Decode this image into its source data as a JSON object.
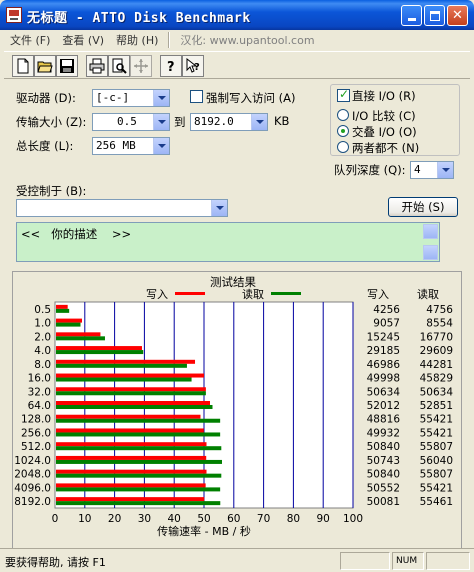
{
  "window": {
    "title": "无标题 - ATTO Disk Benchmark"
  },
  "menu": {
    "items": [
      "文件 (F)",
      "查看 (V)",
      "帮助 (H)"
    ],
    "extra": "汉化: www.upantool.com"
  },
  "toolbar": {
    "icons": [
      "new-file-icon",
      "open-folder-icon",
      "save-icon",
      "print-icon",
      "print-preview-icon",
      "move-icon",
      "help-icon",
      "context-help-icon"
    ]
  },
  "form": {
    "drive_label": "驱动器 (D):",
    "drive_value": "[-c-]",
    "force_write_label": "强制写入访问 (A)",
    "direct_io_label": "直接 I/O (R)",
    "transfer_size_label": "传输大小 (Z):",
    "transfer_from": "0.5",
    "to_label": "到",
    "transfer_to": "8192.0",
    "kb_label": "KB",
    "total_length_label": "总长度 (L):",
    "total_length_value": "256 MB",
    "io_compare_label": "I/O 比较 (C)",
    "overlapped_io_label": "交叠 I/O (O)",
    "neither_label": "两者都不 (N)",
    "queue_depth_label": "队列深度 (Q):",
    "queue_depth_value": "4",
    "controlled_by_label": "受控制于 (B):",
    "controlled_by_value": "",
    "start_button": "开始 (S)",
    "description": "<<   你的描述    >>"
  },
  "results": {
    "title": "测试结果",
    "legend_write": "写入",
    "legend_read": "读取",
    "col_write": "写入",
    "col_read": "读取",
    "write_color": "#ff0000",
    "read_color": "#008000",
    "rows": [
      {
        "size": "0.5",
        "write": "4256",
        "read": "4756"
      },
      {
        "size": "1.0",
        "write": "9057",
        "read": "8554"
      },
      {
        "size": "2.0",
        "write": "15245",
        "read": "16770"
      },
      {
        "size": "4.0",
        "write": "29185",
        "read": "29609"
      },
      {
        "size": "8.0",
        "write": "46986",
        "read": "44281"
      },
      {
        "size": "16.0",
        "write": "49998",
        "read": "45829"
      },
      {
        "size": "32.0",
        "write": "50634",
        "read": "50634"
      },
      {
        "size": "64.0",
        "write": "52012",
        "read": "52851"
      },
      {
        "size": "128.0",
        "write": "48816",
        "read": "55421"
      },
      {
        "size": "256.0",
        "write": "49932",
        "read": "55421"
      },
      {
        "size": "512.0",
        "write": "50840",
        "read": "55807"
      },
      {
        "size": "1024.0",
        "write": "50743",
        "read": "56040"
      },
      {
        "size": "2048.0",
        "write": "50840",
        "read": "55807"
      },
      {
        "size": "4096.0",
        "write": "50552",
        "read": "55421"
      },
      {
        "size": "8192.0",
        "write": "50081",
        "read": "55461"
      }
    ],
    "xlabel": "传输速率 - MB / 秒"
  },
  "chart_data": {
    "type": "bar",
    "orientation": "horizontal",
    "categories": [
      "0.5",
      "1.0",
      "2.0",
      "4.0",
      "8.0",
      "16.0",
      "32.0",
      "64.0",
      "128.0",
      "256.0",
      "512.0",
      "1024.0",
      "2048.0",
      "4096.0",
      "8192.0"
    ],
    "series": [
      {
        "name": "写入",
        "color": "#ff0000",
        "values": [
          4.256,
          9.057,
          15.245,
          29.185,
          46.986,
          49.998,
          50.634,
          52.012,
          48.816,
          49.932,
          50.84,
          50.743,
          50.84,
          50.552,
          50.081
        ]
      },
      {
        "name": "读取",
        "color": "#008000",
        "values": [
          4.756,
          8.554,
          16.77,
          29.609,
          44.281,
          45.829,
          50.634,
          52.851,
          55.421,
          55.421,
          55.807,
          56.04,
          55.807,
          55.421,
          55.461
        ]
      }
    ],
    "title": "测试结果",
    "xlabel": "传输速率 - MB / 秒",
    "xlim": [
      0,
      100
    ],
    "xticks": [
      0,
      10,
      20,
      30,
      40,
      50,
      60,
      70,
      80,
      90,
      100
    ],
    "grid": true,
    "legend": "top"
  },
  "status": {
    "text": "要获得帮助, 请按 F1",
    "num": "NUM"
  }
}
